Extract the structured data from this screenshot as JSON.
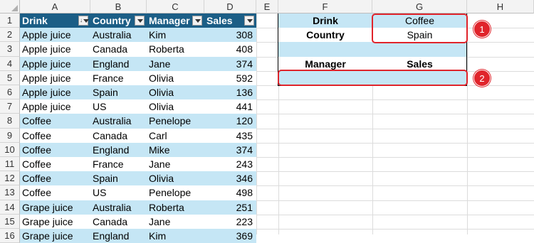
{
  "columns": [
    "A",
    "B",
    "C",
    "D",
    "E",
    "F",
    "G",
    "H"
  ],
  "rows": [
    "1",
    "2",
    "3",
    "4",
    "5",
    "6",
    "7",
    "8",
    "9",
    "10",
    "11",
    "12",
    "13",
    "14",
    "15",
    "16"
  ],
  "table": {
    "headers": [
      "Drink",
      "Country",
      "Manager",
      "Sales"
    ],
    "rows": [
      [
        "Apple juice",
        "Australia",
        "Kim",
        "308"
      ],
      [
        "Apple juice",
        "Canada",
        "Roberta",
        "408"
      ],
      [
        "Apple juice",
        "England",
        "Jane",
        "374"
      ],
      [
        "Apple juice",
        "France",
        "Olivia",
        "592"
      ],
      [
        "Apple juice",
        "Spain",
        "Olivia",
        "136"
      ],
      [
        "Apple juice",
        "US",
        "Olivia",
        "441"
      ],
      [
        "Coffee",
        "Australia",
        "Penelope",
        "120"
      ],
      [
        "Coffee",
        "Canada",
        "Carl",
        "435"
      ],
      [
        "Coffee",
        "England",
        "Mike",
        "374"
      ],
      [
        "Coffee",
        "France",
        "Jane",
        "243"
      ],
      [
        "Coffee",
        "Spain",
        "Olivia",
        "346"
      ],
      [
        "Coffee",
        "US",
        "Penelope",
        "498"
      ],
      [
        "Grape juice",
        "Australia",
        "Roberta",
        "251"
      ],
      [
        "Grape juice",
        "Canada",
        "Jane",
        "223"
      ],
      [
        "Grape juice",
        "England",
        "Kim",
        "369"
      ]
    ]
  },
  "criteria": {
    "drink_label": "Drink",
    "drink_value": "Coffee",
    "country_label": "Country",
    "country_value": "Spain",
    "manager_label": "Manager",
    "sales_label": "Sales"
  },
  "callouts": [
    "1",
    "2"
  ],
  "colors": {
    "header_fill": "#1b5e86",
    "band_fill": "#c5e6f5",
    "callout_red": "#e0242b"
  }
}
